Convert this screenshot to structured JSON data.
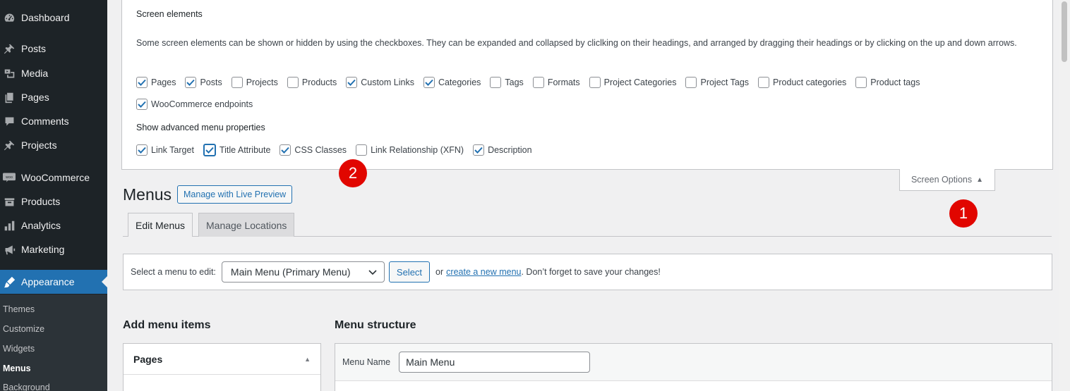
{
  "sidebar": {
    "items": [
      {
        "label": "Dashboard",
        "icon": "dashboard-icon"
      },
      {
        "label": "Posts",
        "icon": "pin-icon"
      },
      {
        "label": "Media",
        "icon": "media-icon"
      },
      {
        "label": "Pages",
        "icon": "pages-icon"
      },
      {
        "label": "Comments",
        "icon": "comments-icon"
      },
      {
        "label": "Projects",
        "icon": "pin-icon"
      },
      {
        "label": "WooCommerce",
        "icon": "woo-icon"
      },
      {
        "label": "Products",
        "icon": "products-icon"
      },
      {
        "label": "Analytics",
        "icon": "analytics-icon"
      },
      {
        "label": "Marketing",
        "icon": "megaphone-icon"
      },
      {
        "label": "Appearance",
        "icon": "brush-icon"
      }
    ],
    "submenu": [
      "Themes",
      "Customize",
      "Widgets",
      "Menus",
      "Background"
    ],
    "active_color": "#2271b1"
  },
  "screen_options": {
    "screen_elements_title": "Screen elements",
    "description": "Some screen elements can be shown or hidden by using the checkboxes. They can be expanded and collapsed by cliclking on their headings, and arranged by dragging their headings or by clicking on the up and down arrows.",
    "elements": [
      {
        "label": "Pages",
        "checked": true
      },
      {
        "label": "Posts",
        "checked": true
      },
      {
        "label": "Projects",
        "checked": false
      },
      {
        "label": "Products",
        "checked": false
      },
      {
        "label": "Custom Links",
        "checked": true
      },
      {
        "label": "Categories",
        "checked": true
      },
      {
        "label": "Tags",
        "checked": false
      },
      {
        "label": "Formats",
        "checked": false
      },
      {
        "label": "Project Categories",
        "checked": false
      },
      {
        "label": "Project Tags",
        "checked": false
      },
      {
        "label": "Product categories",
        "checked": false
      },
      {
        "label": "Product tags",
        "checked": false
      },
      {
        "label": "WooCommerce endpoints",
        "checked": true
      }
    ],
    "advanced_title": "Show advanced menu properties",
    "advanced": [
      {
        "label": "Link Target",
        "checked": true
      },
      {
        "label": "Title Attribute",
        "checked": true
      },
      {
        "label": "CSS Classes",
        "checked": true
      },
      {
        "label": "Link Relationship (XFN)",
        "checked": false
      },
      {
        "label": "Description",
        "checked": true
      }
    ],
    "tab_label": "Screen Options"
  },
  "markers": {
    "one": "1",
    "two": "2",
    "color": "#e10600"
  },
  "main": {
    "title": "Menus",
    "live_preview_label": "Manage with Live Preview",
    "tabs": [
      "Edit Menus",
      "Manage Locations"
    ],
    "select_label": "Select a menu to edit:",
    "selected_menu": "Main Menu (Primary Menu)",
    "select_button": "Select",
    "or_text": "or",
    "create_link": "create a new menu",
    "save_note": ". Don’t forget to save your changes!",
    "add_items_title": "Add menu items",
    "structure_title": "Menu structure",
    "pages_box_title": "Pages",
    "menu_name_label": "Menu Name",
    "menu_name_value": "Main Menu"
  }
}
